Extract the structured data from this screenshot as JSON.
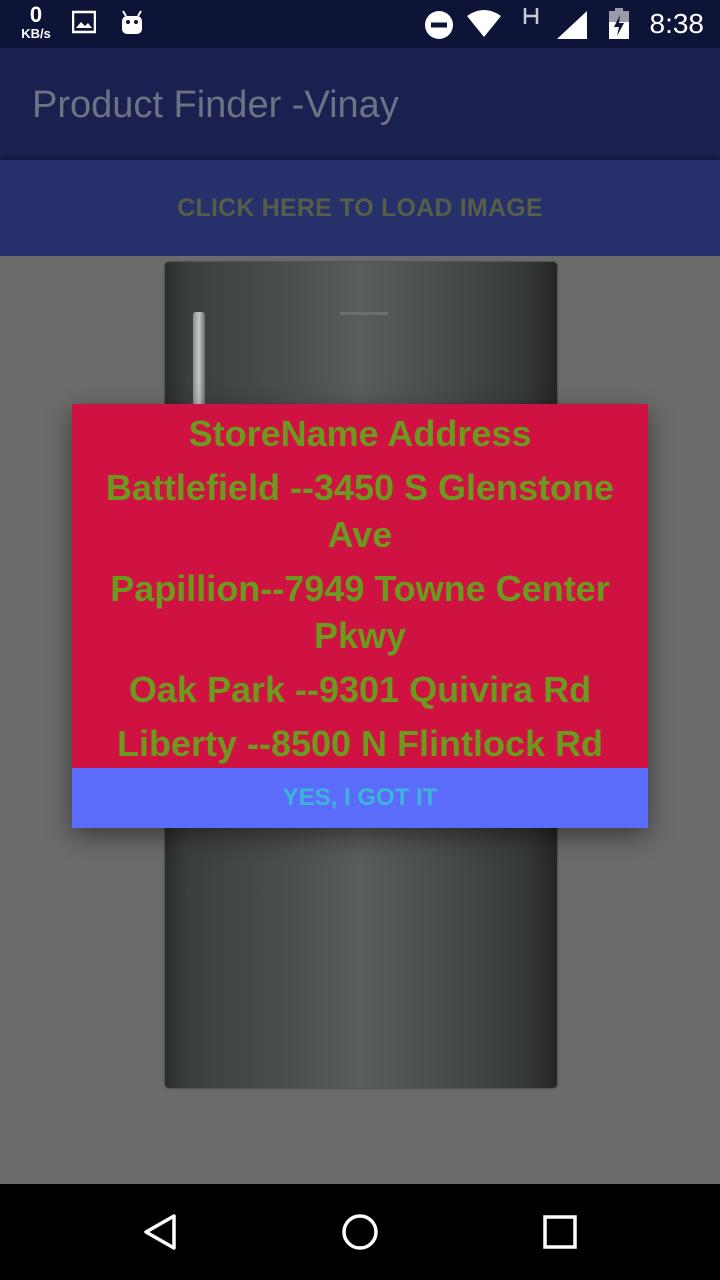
{
  "status_bar": {
    "speed_value": "0",
    "speed_unit": "KB/s",
    "time": "8:38",
    "icons": [
      "image-icon",
      "android-icon",
      "do-not-disturb-icon",
      "wifi-icon",
      "h-network-icon",
      "signal-icon",
      "battery-icon"
    ]
  },
  "app_bar": {
    "title": "Product Finder -Vinay"
  },
  "main": {
    "load_button_label": "CLICK HERE TO LOAD IMAGE",
    "image_description": "refrigerator-image"
  },
  "dialog": {
    "lines": [
      "StoreName  Address",
      "Battlefield --3450 S Glenstone Ave",
      "Papillion--7949 Towne Center Pkwy",
      "Oak Park  --9301 Quivira Rd",
      "Liberty --8500 N Flintlock Rd"
    ],
    "confirm_label": "YES, I GOT IT"
  },
  "nav_bar": {
    "items": [
      "back-icon",
      "home-icon",
      "recents-icon"
    ]
  },
  "colors": {
    "status_bar": "#0e1438",
    "app_bar": "#1a2150",
    "load_button": "#26306a",
    "dialog_bg": "#cf1241",
    "dialog_text": "#6b9a1f",
    "dialog_button": "#5b6cfb",
    "dialog_button_text": "#3db5d8"
  }
}
